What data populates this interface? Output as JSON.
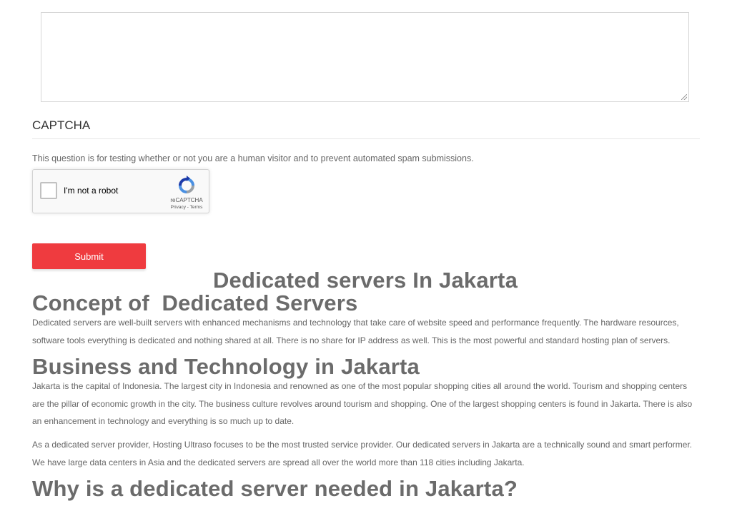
{
  "form": {
    "message_value": "",
    "captcha_heading": "CAPTCHA",
    "captcha_description": "This question is for testing whether or not you are a human visitor and to prevent automated spam submissions.",
    "recaptcha": {
      "label": "I'm not a robot",
      "brand": "reCAPTCHA",
      "privacy_link": "Privacy",
      "separator": " - ",
      "terms_link": "Terms",
      "checked": false
    },
    "submit_label": "Submit"
  },
  "article": {
    "title": "Dedicated servers In Jakarta",
    "sections": [
      {
        "heading": "Concept of  Dedicated Servers",
        "paragraphs": [
          "Dedicated servers are well-built servers with enhanced mechanisms and technology that take care of website speed and performance frequently. The hardware resources, software tools everything is dedicated and nothing shared at all. There is no share for IP address as well. This is the most powerful and standard hosting plan of servers."
        ]
      },
      {
        "heading": "Business and Technology in Jakarta",
        "paragraphs": [
          "Jakarta is the capital of Indonesia. The largest city in Indonesia and renowned as one of the most popular shopping cities all around the world. Tourism and shopping centers are the pillar of economic growth in the city. The business culture revolves around tourism and shopping. One of the largest shopping centers is found in Jakarta. There is also an enhancement in technology and everything is so much up to date.",
          "As a dedicated server provider, Hosting Ultraso focuses to be the most trusted service provider. Our dedicated servers in Jakarta are a technically sound and smart performer. We have large data centers in Asia and the dedicated servers are spread all over the world more than 118 cities including Jakarta."
        ]
      },
      {
        "heading": "Why is a dedicated server needed in Jakarta?",
        "paragraphs": []
      }
    ]
  },
  "colors": {
    "submit_button": "#ef3b3f",
    "heading_text": "#6b6b6b",
    "body_text": "#666666",
    "recaptcha_blue": "#4a90e2"
  },
  "icons": {
    "recaptcha_logo": "recaptcha-icon",
    "textarea_resize": "resize-grip-icon"
  }
}
